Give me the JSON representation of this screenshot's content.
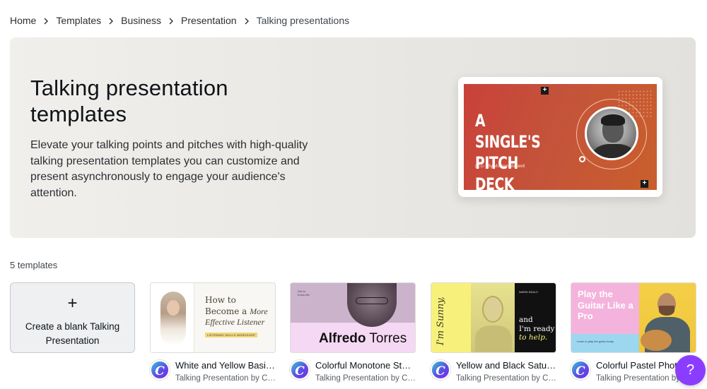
{
  "breadcrumb": {
    "items": [
      "Home",
      "Templates",
      "Business",
      "Presentation",
      "Talking presentations"
    ]
  },
  "hero": {
    "title": "Talking presentation templates",
    "description": "Elevate your talking points and pitches with high-quality talking presentation templates you can customize and present asynchronously to engage your audience's attention.",
    "preview": {
      "headline_line1": "A SINGLE'S",
      "headline_line2": "PITCH DECK",
      "author": "By Morgan Maxwell",
      "colors": {
        "gradient_start": "#c9413a",
        "gradient_end": "#c95f2c"
      }
    }
  },
  "results": {
    "count_label": "5 templates"
  },
  "blank_tile": {
    "plus": "+",
    "label": "Create a blank Talking Presentation"
  },
  "templates": [
    {
      "title": "White and Yellow Basic Talking Presentation",
      "subtitle": "Talking Presentation by Canva Creative Studio",
      "thumb": {
        "line1": "How to",
        "line2": "Become a ",
        "line2_italic": "More",
        "line3_italic": "Effective Listener",
        "tag": "LISTENING SKILLS WORKSHOP"
      }
    },
    {
      "title": "Colorful Monotone Student Talking Presentation",
      "subtitle": "Talking Presentation by Canva Creative Studio",
      "thumb": {
        "small": "Get to Know Me",
        "first": "Alfredo",
        "last": " Torres"
      }
    },
    {
      "title": "Yellow and Black Saturated Talking Presentation",
      "subtitle": "Talking Presentation by Canva Creative Studio",
      "thumb": {
        "vertical": "I'm Sunny,",
        "line1": "and",
        "line2": "I'm ready",
        "line3_italic": "to help.",
        "small": "WARM DEALS"
      }
    },
    {
      "title": "Colorful Pastel Photo Talking Presentation",
      "subtitle": "Talking Presentation by Canva Creative Studio",
      "thumb": {
        "heading": "Play the Guitar Like a Pro",
        "small": "Learn to play the guitar today"
      }
    }
  ],
  "help": {
    "label": "?"
  },
  "colors": {
    "accent": "#8b3dff",
    "hero_bg": "#ebe9e5"
  }
}
